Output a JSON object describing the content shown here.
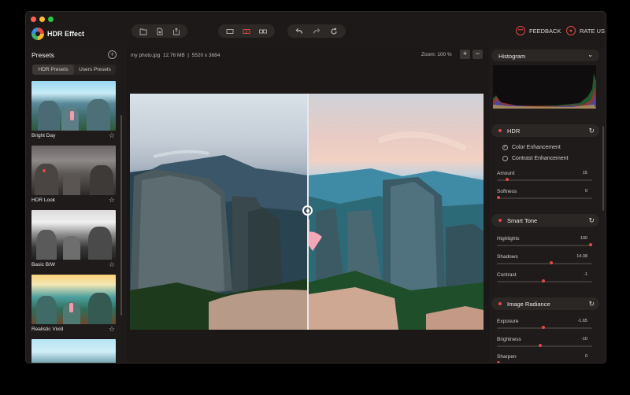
{
  "app": {
    "title": "HDR Effect"
  },
  "toolbar": {
    "feedback_label": "FEEDBACK",
    "rate_label": "RATE US",
    "icons": [
      "open-folder-icon",
      "import-icon",
      "export-icon",
      "single-view-icon",
      "split-view-icon",
      "side-by-side-icon",
      "undo-icon",
      "redo-icon",
      "reset-icon"
    ]
  },
  "presets": {
    "title": "Presets",
    "tabs": [
      "HDR Presets",
      "Users Presets"
    ],
    "items": [
      {
        "label": "Bright Day"
      },
      {
        "label": "HDR Look"
      },
      {
        "label": "Basic B/W"
      },
      {
        "label": "Realistic Vivid"
      }
    ]
  },
  "canvas": {
    "file_name": "my photo.jpg",
    "file_size": "12.76 MB",
    "dimensions": "5520 x 3684",
    "zoom_label": "Zoom: 100 %"
  },
  "panel": {
    "histogram": {
      "title": "Histogram"
    },
    "hdr": {
      "title": "HDR",
      "options": [
        "Color Enhancement",
        "Contrast Enhancement"
      ],
      "sliders": [
        {
          "label": "Amount",
          "value": "15",
          "fraction": 0.09
        },
        {
          "label": "Softness",
          "value": "0",
          "fraction": 0.0
        }
      ]
    },
    "smart_tone": {
      "title": "Smart Tone",
      "sliders": [
        {
          "label": "Highlights",
          "value": "100",
          "fraction": 1.0
        },
        {
          "label": "Shadows",
          "value": "14.08",
          "fraction": 0.57
        },
        {
          "label": "Contrast",
          "value": "-1",
          "fraction": 0.49
        }
      ]
    },
    "image_radiance": {
      "title": "Image Radiance",
      "sliders": [
        {
          "label": "Exposure",
          "value": "-1.65",
          "fraction": 0.49
        },
        {
          "label": "Brightness",
          "value": "-10",
          "fraction": 0.45
        },
        {
          "label": "Sharpen",
          "value": "0",
          "fraction": 0.0
        }
      ]
    }
  },
  "colors": {
    "accent": "#e04848",
    "panel_bg": "#1e1b1a",
    "section_bg": "#2b2725"
  }
}
